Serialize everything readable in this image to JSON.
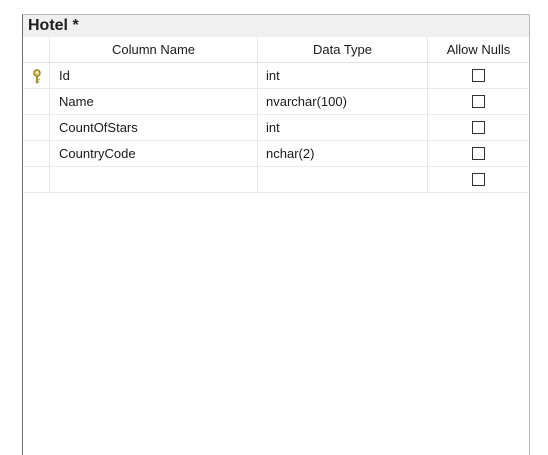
{
  "table": {
    "title": "Hotel *"
  },
  "grid": {
    "headers": {
      "column_name": "Column Name",
      "data_type": "Data Type",
      "allow_nulls": "Allow Nulls"
    },
    "rows": [
      {
        "column_name": "Id",
        "data_type": "int",
        "allow_nulls": false,
        "primary_key": true
      },
      {
        "column_name": "Name",
        "data_type": "nvarchar(100)",
        "allow_nulls": false,
        "primary_key": false
      },
      {
        "column_name": "CountOfStars",
        "data_type": "int",
        "allow_nulls": false,
        "primary_key": false
      },
      {
        "column_name": "CountryCode",
        "data_type": "nchar(2)",
        "allow_nulls": false,
        "primary_key": false
      },
      {
        "column_name": "",
        "data_type": "",
        "allow_nulls": false,
        "primary_key": false
      }
    ]
  },
  "icons": {
    "primary_key": "key-icon",
    "checkbox": "checkbox-unchecked"
  },
  "colors": {
    "key_icon": "#c9a227"
  }
}
